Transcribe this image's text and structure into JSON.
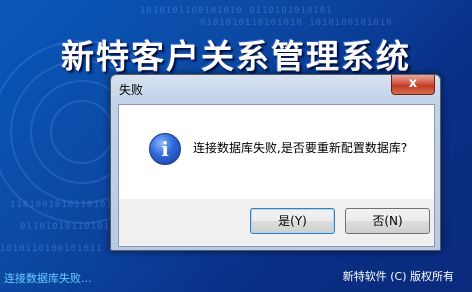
{
  "background": {
    "app_title": "新特客户关系管理系统",
    "binary_lines": [
      "1010101100101010 0110101010101",
      "0101010110101010 1010100101010",
      "1101001010110101 0101010101011",
      "0110101011010100 1011010101001",
      "1010110100101011 0101101010100"
    ],
    "status_text": "连接数据库失败...",
    "copyright": "新特软件 (C) 版权所有"
  },
  "dialog": {
    "title": "失败",
    "close_glyph": "x",
    "icon": "info-icon",
    "icon_glyph": "i",
    "message": "连接数据库失败,是否要重新配置数据库?",
    "yes_label": "是(Y)",
    "no_label": "否(N)"
  },
  "colors": {
    "background_blue": "#0b4aa5",
    "status_text": "#66ccff",
    "close_button": "#c23b24"
  }
}
